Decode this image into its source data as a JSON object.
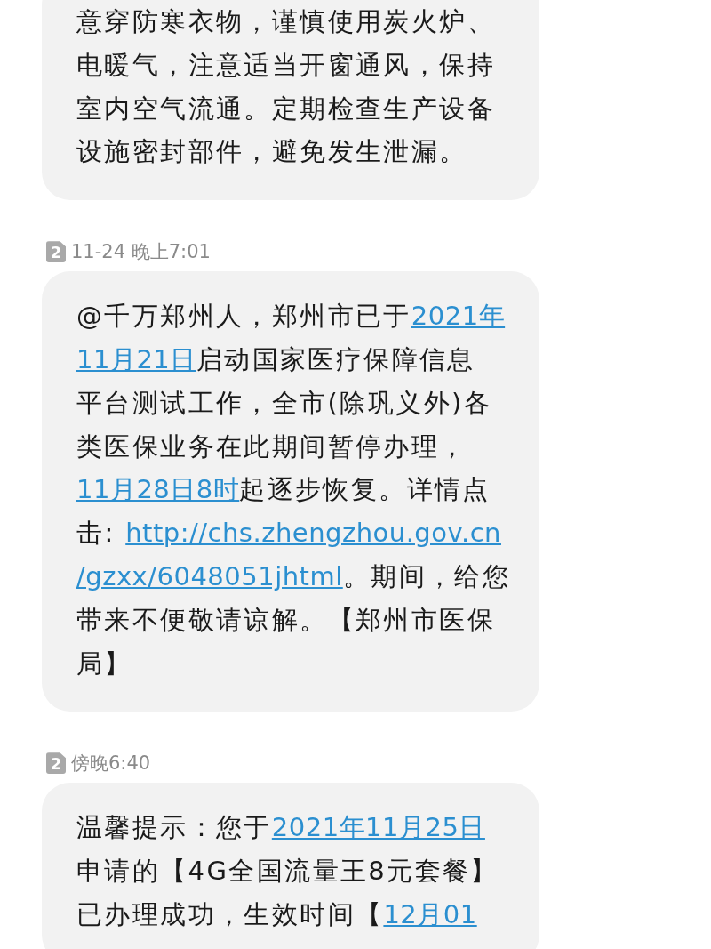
{
  "messages": [
    {
      "lines": [
        [
          {
            "kind": "text",
            "text": "意穿防寒衣物，谨慎使用炭火炉、"
          }
        ],
        [
          {
            "kind": "text",
            "text": "电暖气，注意适当开窗通风，保持"
          }
        ],
        [
          {
            "kind": "text",
            "text": "室内空气流通。定期检查生产设备"
          }
        ],
        [
          {
            "kind": "text",
            "text": "设施密封部件，避免发生泄漏。"
          }
        ]
      ]
    },
    {
      "header": {
        "sim": "2",
        "time": "11-24 晚上7:01"
      },
      "lines": [
        [
          {
            "kind": "text",
            "text": "@千万郑州人，郑州市已于"
          },
          {
            "kind": "link",
            "text": "2021年"
          }
        ],
        [
          {
            "kind": "link",
            "text": "11月21日"
          },
          {
            "kind": "text",
            "text": "启动国家医疗保障信息"
          }
        ],
        [
          {
            "kind": "text",
            "text": "平台测试工作，全市(除巩义外)各"
          }
        ],
        [
          {
            "kind": "text",
            "text": "类医保业务在此期间暂停办理，"
          }
        ],
        [
          {
            "kind": "link",
            "text": "11月28日8时"
          },
          {
            "kind": "text",
            "text": "起逐步恢复。详情点"
          }
        ],
        [
          {
            "kind": "text",
            "text": "击: "
          },
          {
            "kind": "link",
            "text": "http://chs.zhengzhou.gov.cn"
          }
        ],
        [
          {
            "kind": "link",
            "text": "/gzxx/6048051jhtml"
          },
          {
            "kind": "text",
            "text": "。期间，给您"
          }
        ],
        [
          {
            "kind": "text",
            "text": "带来不便敬请谅解。【郑州市医保"
          }
        ],
        [
          {
            "kind": "text",
            "text": "局】"
          }
        ]
      ]
    },
    {
      "header": {
        "sim": "2",
        "time": "傍晚6:40"
      },
      "lines": [
        [
          {
            "kind": "text",
            "text": "温馨提示：您于"
          },
          {
            "kind": "link",
            "text": "2021年11月25日"
          }
        ],
        [
          {
            "kind": "text",
            "text": "申请的【4G全国流量王8元套餐】"
          }
        ],
        [
          {
            "kind": "text",
            "text": "已办理成功，生效时间【"
          },
          {
            "kind": "link",
            "text": "12月01"
          }
        ]
      ]
    }
  ]
}
